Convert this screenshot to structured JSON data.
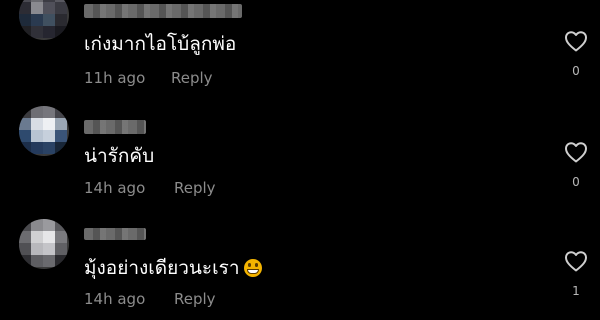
{
  "comments": [
    {
      "text": "เก่งมากไอโบ้ลูกพ่อ",
      "time": "11h ago",
      "reply": "Reply",
      "likes": "0",
      "emoji": ""
    },
    {
      "text": "น่ารักคับ",
      "time": "14h ago",
      "reply": "Reply",
      "likes": "0",
      "emoji": ""
    },
    {
      "text": "มุ้งอย่างเดียวนะเรา",
      "time": "14h ago",
      "reply": "Reply",
      "likes": "1",
      "emoji": "grinning-face-emoji"
    }
  ],
  "colors": {
    "background": "#000000",
    "text": "#ffffff",
    "meta": "#8c8c8c",
    "like_icon": "#cfcfcf"
  },
  "icons": {
    "like": "heart-outline-icon",
    "avatar": "blurred-avatar"
  }
}
